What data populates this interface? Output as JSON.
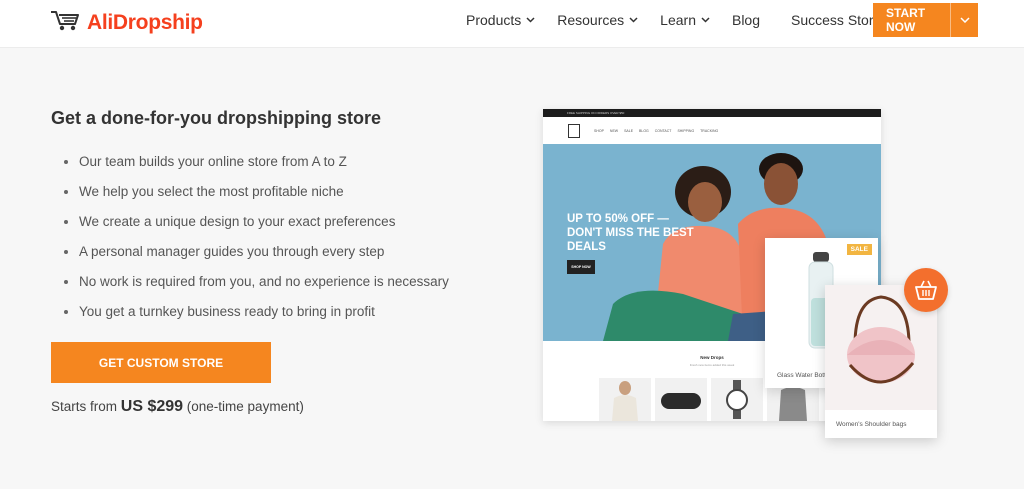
{
  "header": {
    "logo_text": "AliDropship",
    "nav": [
      {
        "label": "Products"
      },
      {
        "label": "Resources"
      },
      {
        "label": "Learn"
      },
      {
        "label": "Blog"
      },
      {
        "label": "Success Stories"
      }
    ],
    "cta_label": "START NOW"
  },
  "main": {
    "title": "Get a done-for-you dropshipping store",
    "features": [
      "Our team builds your online store from A to Z",
      "We help you select the most profitable niche",
      "We create a unique design to your exact preferences",
      "A personal manager guides you through every step",
      "No work is required from you, and no experience is necessary",
      "You get a turnkey business ready to bring in profit"
    ],
    "cta_label": "GET CUSTOM STORE",
    "price_prefix": "Starts from ",
    "price_amount": "US $299",
    "price_suffix": " (one-time payment)"
  },
  "mockup": {
    "topbar_text": "FREE SHIPPING ON ORDERS OVER $50",
    "nav_items": [
      "SHOP",
      "NEW",
      "SALE",
      "BLOG",
      "CONTACT",
      "SHIPPING",
      "TRACKING"
    ],
    "hero_text": "UP TO 50% OFF — DON'T MISS THE BEST DEALS",
    "shop_button": "SHOP NOW",
    "section_title": "New Drops",
    "section_subtitle": "Fresh new items added this week",
    "card1_badge": "SALE",
    "card1_name": "Glass Water Bottle",
    "card2_name": "Women's Shoulder bags"
  },
  "colors": {
    "accent": "#f5861f",
    "logo": "#f5401e",
    "hero_bg": "#7ab3cf"
  }
}
